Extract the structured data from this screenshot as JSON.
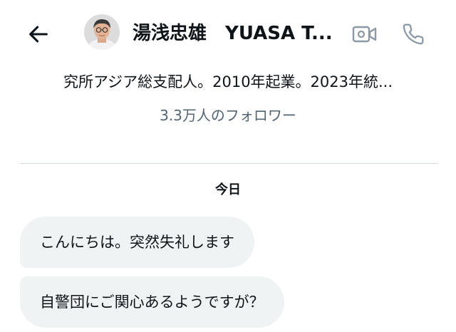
{
  "header": {
    "title": "湯浅忠雄　YUASA T...",
    "back_icon": "arrow-left-icon",
    "video_icon": "video-camera-icon",
    "call_icon": "phone-icon",
    "avatar_icon": "avatar"
  },
  "profile": {
    "bio": "究所アジア総支配人。2010年起業。2023年統...",
    "followers": "3.3万人のフォロワー"
  },
  "conversation": {
    "date_label": "今日",
    "messages": [
      {
        "text": "こんにちは。突然失礼します"
      },
      {
        "text": "自警団にご関心あるようですが？"
      }
    ]
  },
  "colors": {
    "text": "#0f1419",
    "secondary_text": "#536471",
    "bubble_bg": "#eff3f4",
    "divider": "#cfd9de",
    "icon_gray": "#8b98a5"
  }
}
